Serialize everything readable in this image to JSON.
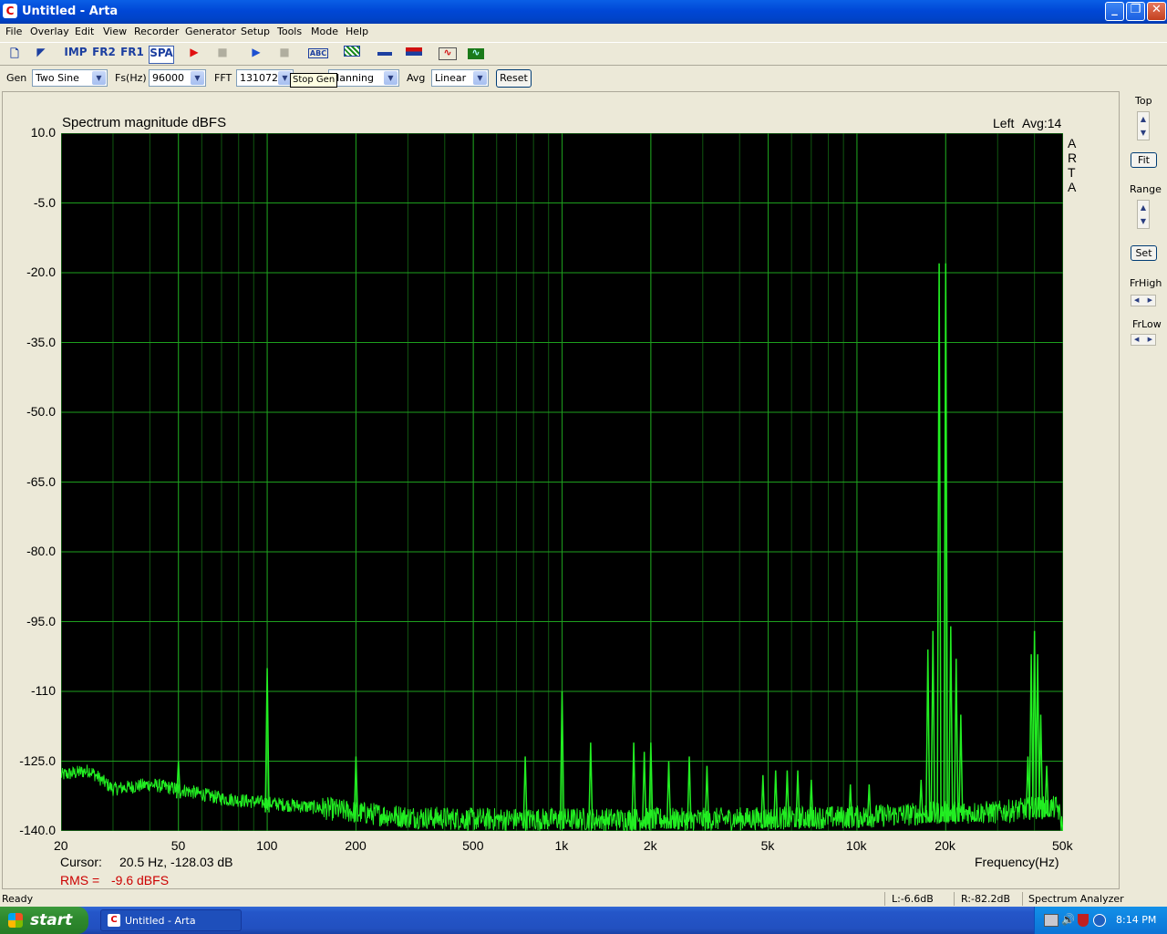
{
  "window": {
    "title": "Untitled - Arta",
    "app_icon": "arta-logo-icon",
    "buttons": [
      "minimize-icon",
      "restore-icon",
      "close-icon"
    ]
  },
  "menu": [
    "File",
    "Overlay",
    "Edit",
    "View",
    "Recorder",
    "Generator",
    "Setup",
    "Tools",
    "Mode",
    "Help"
  ],
  "toolbar": {
    "buttons": [
      "new-file-icon",
      "open-file-icon",
      "IMP",
      "FR2",
      "FR1",
      "SPA",
      "record-icon",
      "stop-icon",
      "play-icon",
      "stop-gen-icon",
      "abc-icon",
      "pattern-icon",
      "slider-icon",
      "flag-icon",
      "sine-icon",
      "scope-icon"
    ],
    "imp_label": "IMP",
    "fr2_label": "FR2",
    "fr1_label": "FR1",
    "spa_label": "SPA",
    "tooltip": "Stop Gen"
  },
  "controls": {
    "gen_label": "Gen",
    "gen_value": "Two Sine",
    "fs_label": "Fs(Hz)",
    "fs_value": "96000",
    "fft_label": "FFT",
    "fft_value": "131072",
    "window_value": "Hanning",
    "avg_label": "Avg",
    "avg_value": "Linear",
    "reset_label": "Reset"
  },
  "side_panel": {
    "top_label": "Top",
    "fit_label": "Fit",
    "range_label": "Range",
    "set_label": "Set",
    "frhigh_label": "FrHigh",
    "frlow_label": "FrLow"
  },
  "plot": {
    "channel": "Left",
    "avg": "Avg:14",
    "cursor_label": "Cursor:",
    "cursor_value": "20.5 Hz, -128.03 dB",
    "rms_label": "RMS =",
    "rms_value": "-9.6 dBFS",
    "watermark": "ARTA",
    "colors": {
      "background": "#000000",
      "grid": "#1E9F1E",
      "trace": "#22EE22",
      "rms_text": "#CC0000"
    }
  },
  "chart_data": {
    "type": "line",
    "title": "Spectrum magnitude dBFS",
    "xlabel": "Frequency(Hz)",
    "ylabel": "",
    "x_scale": "log",
    "xlim": [
      20,
      50000
    ],
    "ylim": [
      -140,
      10
    ],
    "x_ticks": [
      20,
      50,
      100,
      200,
      500,
      1000,
      2000,
      5000,
      10000,
      20000,
      50000
    ],
    "x_tick_labels": [
      "20",
      "50",
      "100",
      "200",
      "500",
      "1k",
      "2k",
      "5k",
      "10k",
      "20k",
      "50k"
    ],
    "y_ticks": [
      10,
      -5,
      -20,
      -35,
      -50,
      -65,
      -80,
      -95,
      -110,
      -125,
      -140
    ],
    "y_tick_labels": [
      "10.0",
      "-5.0",
      "-20.0",
      "-35.0",
      "-50.0",
      "-65.0",
      "-80.0",
      "-95.0",
      "-110",
      "-125.0",
      "-140.0"
    ],
    "grid": true,
    "noise_floor": [
      [
        20,
        -128
      ],
      [
        25,
        -127
      ],
      [
        30,
        -131
      ],
      [
        40,
        -130
      ],
      [
        50,
        -131
      ],
      [
        70,
        -133
      ],
      [
        100,
        -134
      ],
      [
        150,
        -135
      ],
      [
        200,
        -136
      ],
      [
        300,
        -137
      ],
      [
        500,
        -137.5
      ],
      [
        1000,
        -137.5
      ],
      [
        3000,
        -137.5
      ],
      [
        10000,
        -137
      ],
      [
        20000,
        -136
      ],
      [
        30000,
        -136
      ],
      [
        40000,
        -135
      ],
      [
        48000,
        -135
      ],
      [
        50000,
        -140
      ]
    ],
    "peaks": [
      {
        "f": 50,
        "db": -125
      },
      {
        "f": 100,
        "db": -105
      },
      {
        "f": 200,
        "db": -124
      },
      {
        "f": 750,
        "db": -124
      },
      {
        "f": 1000,
        "db": -110
      },
      {
        "f": 1250,
        "db": -121
      },
      {
        "f": 1750,
        "db": -121
      },
      {
        "f": 1900,
        "db": -123
      },
      {
        "f": 2000,
        "db": -121
      },
      {
        "f": 2300,
        "db": -125
      },
      {
        "f": 2700,
        "db": -124
      },
      {
        "f": 3100,
        "db": -126
      },
      {
        "f": 4800,
        "db": -128
      },
      {
        "f": 5300,
        "db": -127
      },
      {
        "f": 5800,
        "db": -127
      },
      {
        "f": 6300,
        "db": -127
      },
      {
        "f": 7000,
        "db": -129
      },
      {
        "f": 9500,
        "db": -130
      },
      {
        "f": 11000,
        "db": -130
      },
      {
        "f": 16500,
        "db": -129
      },
      {
        "f": 17400,
        "db": -101
      },
      {
        "f": 18100,
        "db": -97
      },
      {
        "f": 19000,
        "db": -18
      },
      {
        "f": 20000,
        "db": -18
      },
      {
        "f": 20800,
        "db": -96
      },
      {
        "f": 21700,
        "db": -103
      },
      {
        "f": 22500,
        "db": -115
      },
      {
        "f": 38000,
        "db": -124
      },
      {
        "f": 39000,
        "db": -102
      },
      {
        "f": 40000,
        "db": -97
      },
      {
        "f": 41000,
        "db": -102
      },
      {
        "f": 42000,
        "db": -115
      },
      {
        "f": 44000,
        "db": -126
      }
    ]
  },
  "status": {
    "left": "Ready",
    "l_level": "L:-6.6dB",
    "r_level": "R:-82.2dB",
    "mode": "Spectrum Analyzer"
  },
  "taskbar": {
    "start_label": "start",
    "task_label": "Untitled - Arta",
    "clock": "8:14 PM"
  }
}
